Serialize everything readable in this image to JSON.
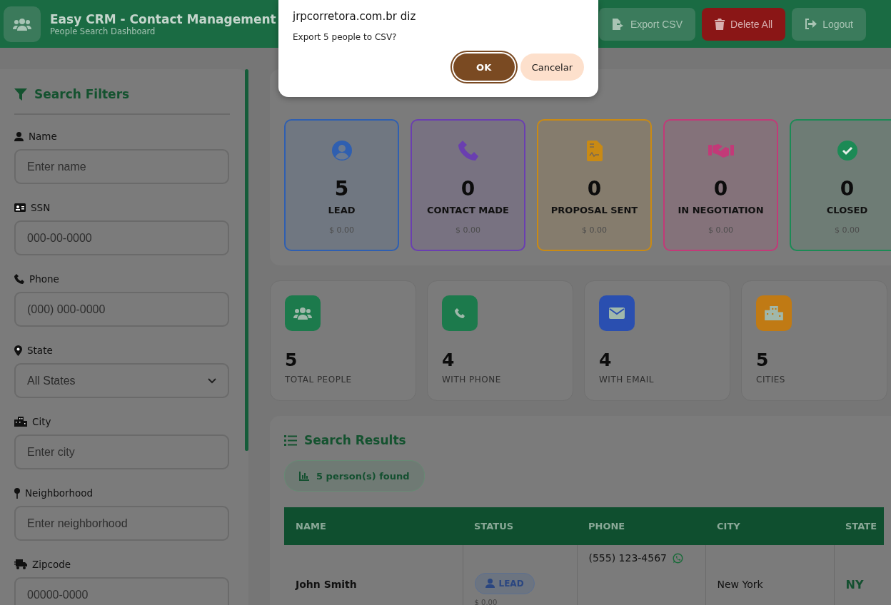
{
  "header": {
    "title": "Easy CRM - Contact Management",
    "subtitle": "People Search Dashboard",
    "buttons": [
      {
        "label": "Export CSV",
        "kind": "export"
      },
      {
        "label": "Delete All",
        "kind": "delete"
      },
      {
        "label": "Logout",
        "kind": "logout"
      }
    ]
  },
  "filters": {
    "title": "Search Filters",
    "fields": [
      {
        "label": "Name",
        "kind": "text",
        "placeholder": "Enter name"
      },
      {
        "label": "SSN",
        "kind": "text",
        "placeholder": "000-00-0000"
      },
      {
        "label": "Phone",
        "kind": "text",
        "placeholder": "(000) 000-0000"
      },
      {
        "label": "State",
        "kind": "select",
        "value": "All States"
      },
      {
        "label": "City",
        "kind": "text",
        "placeholder": "Enter city"
      },
      {
        "label": "Neighborhood",
        "kind": "text",
        "placeholder": "Enter neighborhood"
      },
      {
        "label": "Zipcode",
        "kind": "text",
        "placeholder": "00000-0000"
      }
    ]
  },
  "funnel": {
    "stages": [
      {
        "count": "5",
        "label": "LEAD",
        "amount": "$ 0.00",
        "color": "#2f5fb0"
      },
      {
        "count": "0",
        "label": "CONTACT MADE",
        "amount": "$ 0.00",
        "color": "#6a3fb0"
      },
      {
        "count": "0",
        "label": "PROPOSAL SENT",
        "amount": "$ 0.00",
        "color": "#c98a14"
      },
      {
        "count": "0",
        "label": "IN NEGOTIATION",
        "amount": "$ 0.00",
        "color": "#c23a78"
      },
      {
        "count": "0",
        "label": "CLOSED",
        "amount": "$ 0.00",
        "color": "#1c8a55"
      }
    ]
  },
  "stats": [
    {
      "value": "5",
      "label": "TOTAL PEOPLE",
      "color": "#1c7a4c"
    },
    {
      "value": "4",
      "label": "WITH PHONE",
      "color": "#1c7a4c"
    },
    {
      "value": "4",
      "label": "WITH EMAIL",
      "color": "#2a4fb0"
    },
    {
      "value": "5",
      "label": "CITIES",
      "color": "#c07a14"
    }
  ],
  "results": {
    "title": "Search Results",
    "count": "5 person(s) found",
    "columns": [
      "NAME",
      "STATUS",
      "PHONE",
      "CITY",
      "STATE"
    ],
    "rows": [
      {
        "name": "John Smith",
        "status": "LEAD",
        "amount": "$ 0.00",
        "phone": "(555) 123-4567",
        "city": "New York",
        "state": "NY"
      }
    ]
  },
  "dialog": {
    "title": "jrpcorretora.com.br diz",
    "message": "Export 5 people to CSV?",
    "buttons": [
      {
        "label": "OK",
        "kind": "primary"
      },
      {
        "label": "Cancelar",
        "kind": "secondary"
      }
    ]
  }
}
